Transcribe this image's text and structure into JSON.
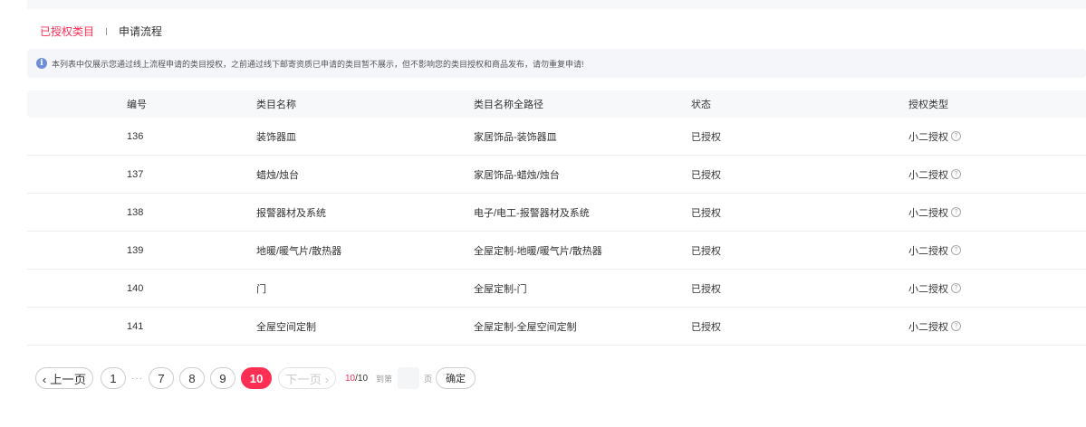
{
  "tabs": [
    {
      "label": "已授权类目",
      "active": true
    },
    {
      "label": "申请流程",
      "active": false
    }
  ],
  "notice": {
    "icon": "info-icon",
    "text": "本列表中仅展示您通过线上流程申请的类目授权，之前通过线下邮寄资质已申请的类目暂不展示，但不影响您的类目授权和商品发布，请勿重复申请!"
  },
  "table": {
    "headers": [
      "编号",
      "类目名称",
      "类目名称全路径",
      "状态",
      "授权类型"
    ],
    "rows": [
      {
        "id": "136",
        "name": "装饰器皿",
        "path": "家居饰品-装饰器皿",
        "status": "已授权",
        "type": "小二授权"
      },
      {
        "id": "137",
        "name": "蜡烛/烛台",
        "path": "家居饰品-蜡烛/烛台",
        "status": "已授权",
        "type": "小二授权"
      },
      {
        "id": "138",
        "name": "报警器材及系统",
        "path": "电子/电工-报警器材及系统",
        "status": "已授权",
        "type": "小二授权"
      },
      {
        "id": "139",
        "name": "地暖/暖气片/散热器",
        "path": "全屋定制-地暖/暖气片/散热器",
        "status": "已授权",
        "type": "小二授权"
      },
      {
        "id": "140",
        "name": "门",
        "path": "全屋定制-门",
        "status": "已授权",
        "type": "小二授权"
      },
      {
        "id": "141",
        "name": "全屋空间定制",
        "path": "全屋定制-全屋空间定制",
        "status": "已授权",
        "type": "小二授权"
      }
    ]
  },
  "pagination": {
    "prev_label": "‹ 上一页",
    "next_label": "下一页 ›",
    "pages": [
      "1",
      "7",
      "8",
      "9",
      "10"
    ],
    "ellipsis": "···",
    "current": "10",
    "total_sep": "/",
    "total": "10",
    "goto_label": "到第",
    "goto_suffix": "页",
    "goto_value": "",
    "confirm_label": "确定"
  },
  "colors": {
    "accent": "#ff2e54",
    "info": "#6d8ed8",
    "header_bg": "#f7f8fa"
  }
}
